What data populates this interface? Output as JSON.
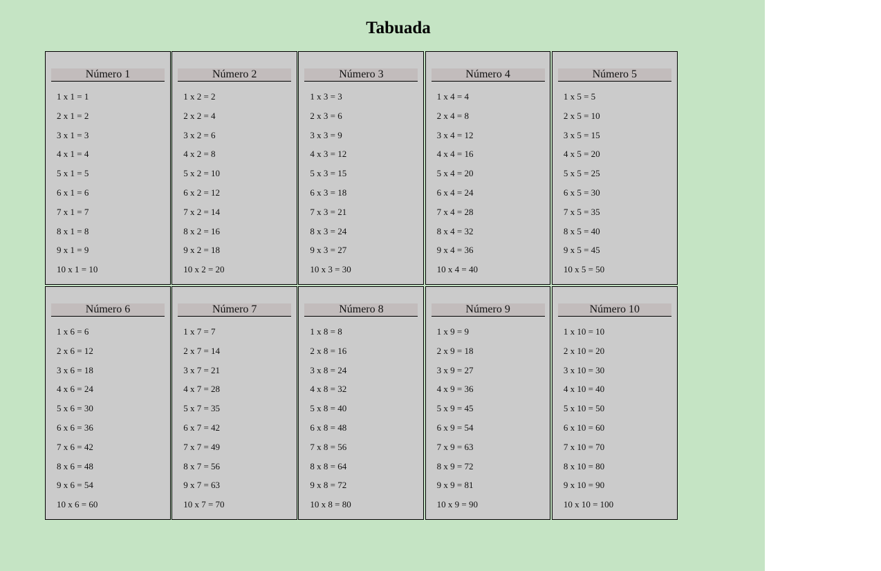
{
  "page": {
    "title": "Tabuada",
    "background_color": "#c5e4c4",
    "card_color": "#cbcbcb",
    "header_color": "#c2bcbc"
  },
  "tables": [
    {
      "title": "Número 1",
      "lines": [
        "1 x 1 = 1",
        "2 x 1 = 2",
        "3 x 1 = 3",
        "4 x 1 = 4",
        "5 x 1 = 5",
        "6 x 1 = 6",
        "7 x 1 = 7",
        "8 x 1 = 8",
        "9 x 1 = 9",
        "10 x 1 = 10"
      ]
    },
    {
      "title": "Número 2",
      "lines": [
        "1 x 2 = 2",
        "2 x 2 = 4",
        "3 x 2 = 6",
        "4 x 2 = 8",
        "5 x 2 = 10",
        "6 x 2 = 12",
        "7 x 2 = 14",
        "8 x 2 = 16",
        "9 x 2 = 18",
        "10 x 2 = 20"
      ]
    },
    {
      "title": "Número 3",
      "lines": [
        "1 x 3 = 3",
        "2 x 3 = 6",
        "3 x 3 = 9",
        "4 x 3 = 12",
        "5 x 3 = 15",
        "6 x 3 = 18",
        "7 x 3 = 21",
        "8 x 3 = 24",
        "9 x 3 = 27",
        "10 x 3 = 30"
      ]
    },
    {
      "title": "Número 4",
      "lines": [
        "1 x 4 = 4",
        "2 x 4 = 8",
        "3 x 4 = 12",
        "4 x 4 = 16",
        "5 x 4 = 20",
        "6 x 4 = 24",
        "7 x 4 = 28",
        "8 x 4 = 32",
        "9 x 4 = 36",
        "10 x 4 = 40"
      ]
    },
    {
      "title": "Número 5",
      "lines": [
        "1 x 5 = 5",
        "2 x 5 = 10",
        "3 x 5 = 15",
        "4 x 5 = 20",
        "5 x 5 = 25",
        "6 x 5 = 30",
        "7 x 5 = 35",
        "8 x 5 = 40",
        "9 x 5 = 45",
        "10 x 5 = 50"
      ]
    },
    {
      "title": "Número 6",
      "lines": [
        "1 x 6 = 6",
        "2 x 6 = 12",
        "3 x 6 = 18",
        "4 x 6 = 24",
        "5 x 6 = 30",
        "6 x 6 = 36",
        "7 x 6 = 42",
        "8 x 6 = 48",
        "9 x 6 = 54",
        "10 x 6 = 60"
      ]
    },
    {
      "title": "Número 7",
      "lines": [
        "1 x 7 = 7",
        "2 x 7 = 14",
        "3 x 7 = 21",
        "4 x 7 = 28",
        "5 x 7 = 35",
        "6 x 7 = 42",
        "7 x 7 = 49",
        "8 x 7 = 56",
        "9 x 7 = 63",
        "10 x 7 = 70"
      ]
    },
    {
      "title": "Número 8",
      "lines": [
        "1 x 8 = 8",
        "2 x 8 = 16",
        "3 x 8 = 24",
        "4 x 8 = 32",
        "5 x 8 = 40",
        "6 x 8 = 48",
        "7 x 8 = 56",
        "8 x 8 = 64",
        "9 x 8 = 72",
        "10 x 8 = 80"
      ]
    },
    {
      "title": "Número 9",
      "lines": [
        "1 x 9 = 9",
        "2 x 9 = 18",
        "3 x 9 = 27",
        "4 x 9 = 36",
        "5 x 9 = 45",
        "6 x 9 = 54",
        "7 x 9 = 63",
        "8 x 9 = 72",
        "9 x 9 = 81",
        "10 x 9 = 90"
      ]
    },
    {
      "title": "Número 10",
      "lines": [
        "1 x 10 = 10",
        "2 x 10 = 20",
        "3 x 10 = 30",
        "4 x 10 = 40",
        "5 x 10 = 50",
        "6 x 10 = 60",
        "7 x 10 = 70",
        "8 x 10 = 80",
        "9 x 10 = 90",
        "10 x 10 = 100"
      ]
    }
  ]
}
